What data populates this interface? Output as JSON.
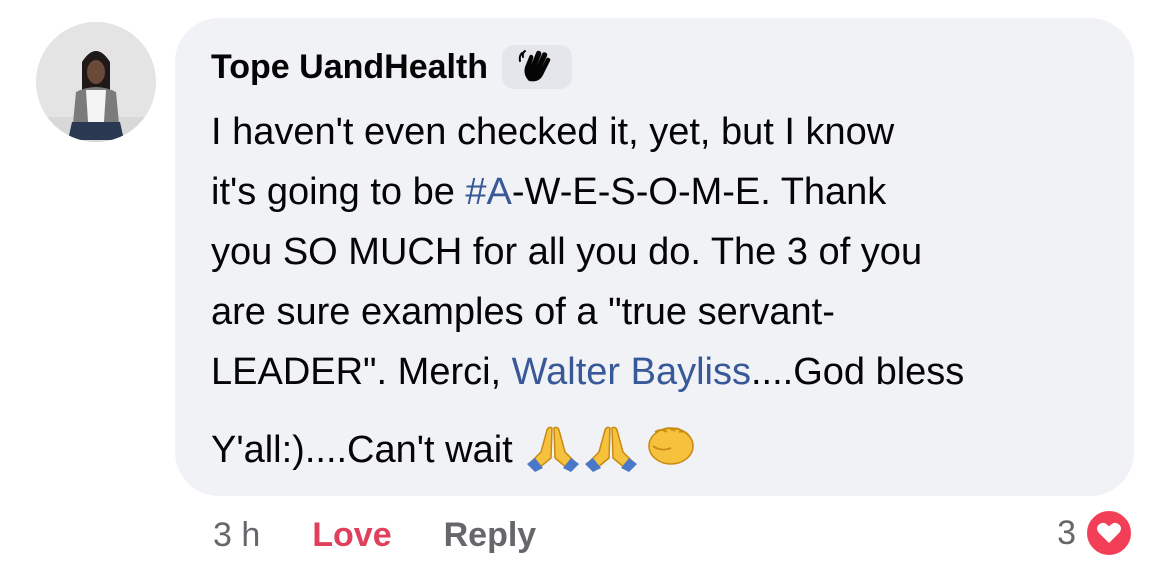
{
  "comment": {
    "author": "Tope UandHealth",
    "author_badge_icon": "waving-hand-icon",
    "avatar_icon": "profile-photo",
    "lines": [
      {
        "pre": "I haven't even checked it, yet, but I know"
      },
      {
        "pre": "it's going to be ",
        "tag": "#A",
        "post": "-W-E-S-O-M-E. Thank"
      },
      {
        "pre": "you SO MUCH for all you do. The 3 of you"
      },
      {
        "pre": "are sure examples of a \"true servant-"
      },
      {
        "pre": "LEADER\". Merci, ",
        "mention": "Walter Bayliss",
        "post": "....God bless"
      },
      {
        "pre": "Y'all:)....Can't wait"
      }
    ],
    "trailing_emojis": [
      "folded-hands-icon",
      "folded-hands-icon",
      "oncoming-fist-icon"
    ],
    "link_color": "#385898"
  },
  "actions": {
    "timestamp": "3 h",
    "love_label": "Love",
    "love_color": "#e0405c",
    "reply_label": "Reply"
  },
  "reactions": {
    "count": "3",
    "icon": "heart-icon",
    "color": "#f33e58"
  }
}
